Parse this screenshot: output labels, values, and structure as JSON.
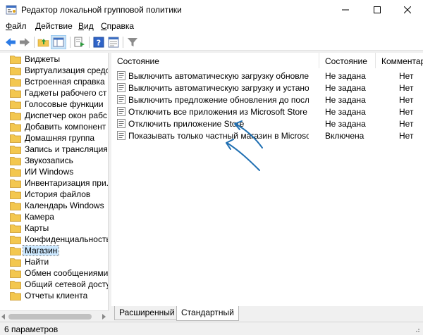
{
  "window": {
    "title": "Редактор локальной групповой политики"
  },
  "menu": {
    "file": {
      "underlined": "Ф",
      "rest": "айл"
    },
    "action": {
      "underlined": "Д",
      "rest": "ействие"
    },
    "view": {
      "underlined": "В",
      "rest": "ид"
    },
    "help": {
      "underlined": "С",
      "rest": "правка"
    }
  },
  "tree": {
    "items": [
      {
        "label": "Виджеты"
      },
      {
        "label": "Виртуализация средс"
      },
      {
        "label": "Встроенная справка"
      },
      {
        "label": "Гаджеты рабочего ст"
      },
      {
        "label": "Голосовые функции"
      },
      {
        "label": "Диспетчер окон рабс"
      },
      {
        "label": "Добавить компонент"
      },
      {
        "label": "Домашняя группа"
      },
      {
        "label": "Запись и трансляция"
      },
      {
        "label": "Звукозапись"
      },
      {
        "label": "ИИ Windows"
      },
      {
        "label": "Инвентаризация при."
      },
      {
        "label": "История файлов"
      },
      {
        "label": "Календарь Windows"
      },
      {
        "label": "Камера"
      },
      {
        "label": "Карты"
      },
      {
        "label": "Конфиденциальность"
      },
      {
        "label": "Магазин"
      },
      {
        "label": "Найти"
      },
      {
        "label": "Обмен сообщениями"
      },
      {
        "label": "Общий сетевой досту"
      },
      {
        "label": "Отчеты клиента"
      }
    ],
    "selected_label": "Магазин"
  },
  "list": {
    "columns": {
      "setting": "Состояние",
      "state": "Состояние",
      "comment": "Комментар"
    },
    "rows": [
      {
        "name": "Выключить автоматическую загрузку обновлени...",
        "state": "Не задана",
        "comment": "Нет"
      },
      {
        "name": "Выключить автоматическую загрузку и установку...",
        "state": "Не задана",
        "comment": "Нет"
      },
      {
        "name": "Выключить предложение обновления до послед...",
        "state": "Не задана",
        "comment": "Нет"
      },
      {
        "name": "Отключить все приложения из Microsoft Store",
        "state": "Не задана",
        "comment": "Нет"
      },
      {
        "name": "Отключить приложение Store",
        "state": "Не задана",
        "comment": "Нет"
      },
      {
        "name": "Показывать только частный магазин в Microsoft S...",
        "state": "Включена",
        "comment": "Нет"
      }
    ]
  },
  "tabs": {
    "extended": "Расширенный",
    "standard": "Стандартный"
  },
  "status": {
    "text": "6 параметров"
  },
  "colors": {
    "selection": "#cce8ff",
    "annotation_arrow": "#1f6fb2",
    "folder": "#f3c74f"
  }
}
